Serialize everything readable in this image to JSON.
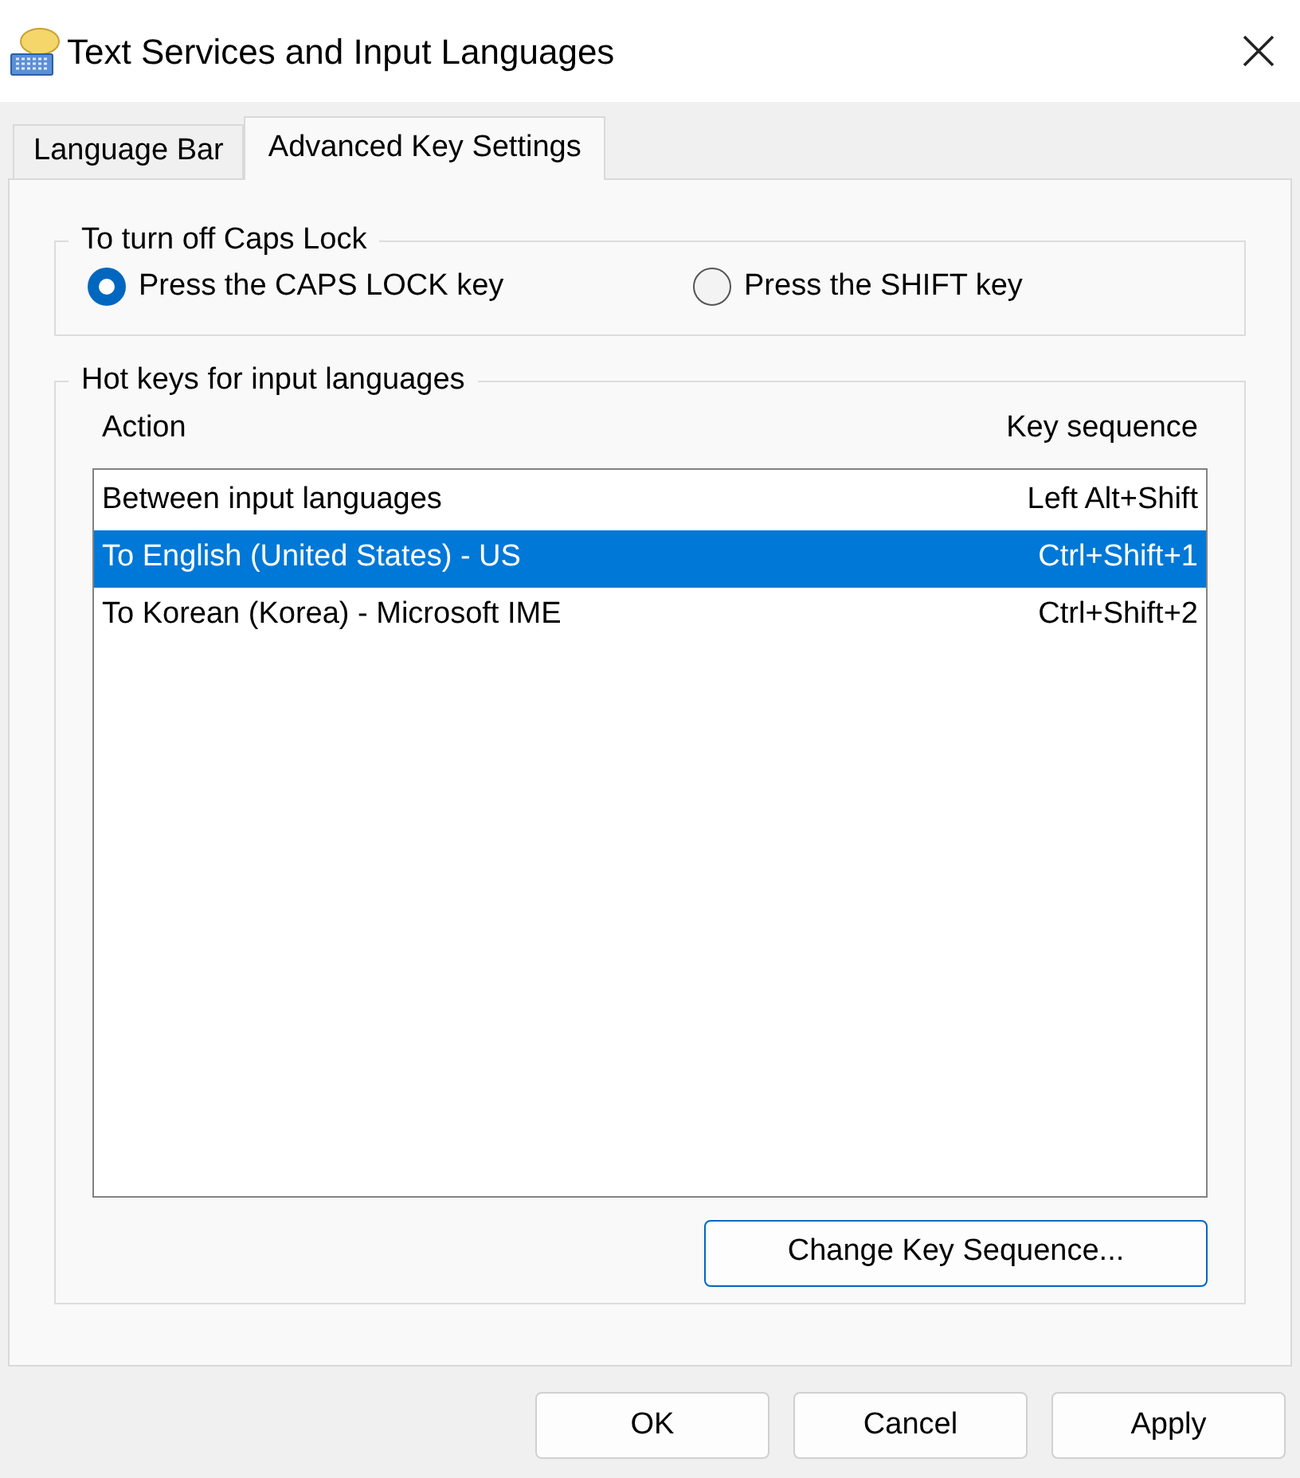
{
  "window": {
    "title": "Text Services and Input Languages"
  },
  "tabs": [
    {
      "label": "Language Bar",
      "selected": false
    },
    {
      "label": "Advanced Key Settings",
      "selected": true
    }
  ],
  "caps_lock": {
    "title": "To turn off Caps Lock",
    "options": [
      {
        "label": "Press the CAPS LOCK key",
        "selected": true
      },
      {
        "label": "Press the SHIFT key",
        "selected": false
      }
    ]
  },
  "hot_keys": {
    "title": "Hot keys for input languages",
    "columns": [
      "Action",
      "Key sequence"
    ],
    "rows": [
      {
        "action": "Between input languages",
        "key_sequence": "Left Alt+Shift",
        "selected": false
      },
      {
        "action": "To English (United States) - US",
        "key_sequence": "Ctrl+Shift+1",
        "selected": true
      },
      {
        "action": "To Korean (Korea) - Microsoft IME",
        "key_sequence": "Ctrl+Shift+2",
        "selected": false
      }
    ],
    "button": "Change Key Sequence..."
  },
  "buttons": [
    "OK",
    "Cancel",
    "Apply"
  ]
}
